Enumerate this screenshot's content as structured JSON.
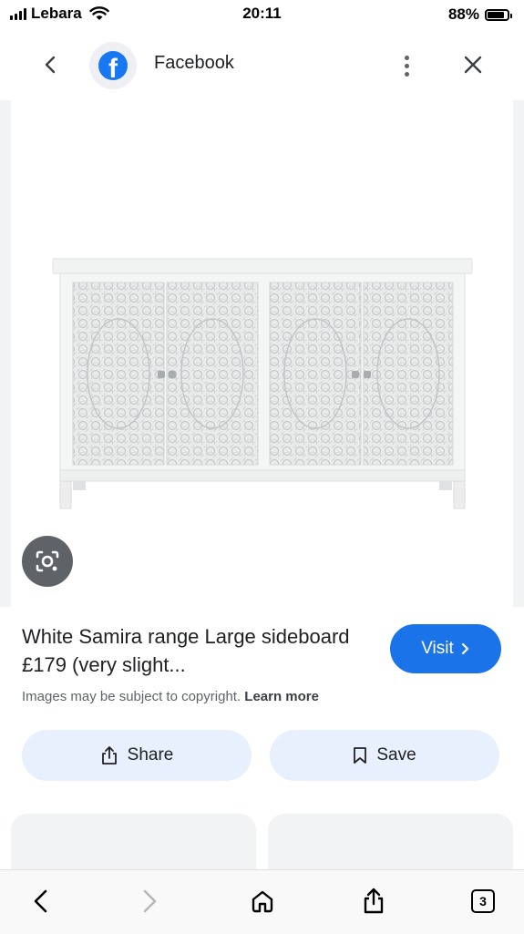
{
  "status_bar": {
    "carrier": "Lebara",
    "time": "20:11",
    "battery": "88%",
    "battery_level": 0.88
  },
  "header": {
    "site_name": "Facebook",
    "site_icon": "facebook-logo-icon"
  },
  "result": {
    "title": "White Samira range Large sideboard £179 (very slight...",
    "visit_label": "Visit",
    "copyright_text": "Images may be subject to copyright.",
    "learn_more": "Learn more"
  },
  "actions": {
    "share_label": "Share",
    "save_label": "Save"
  },
  "toolbar": {
    "tab_count": "3"
  },
  "colors": {
    "accent": "#1a73e8",
    "pill": "#e8f0fe",
    "facebook": "#1877f2"
  }
}
